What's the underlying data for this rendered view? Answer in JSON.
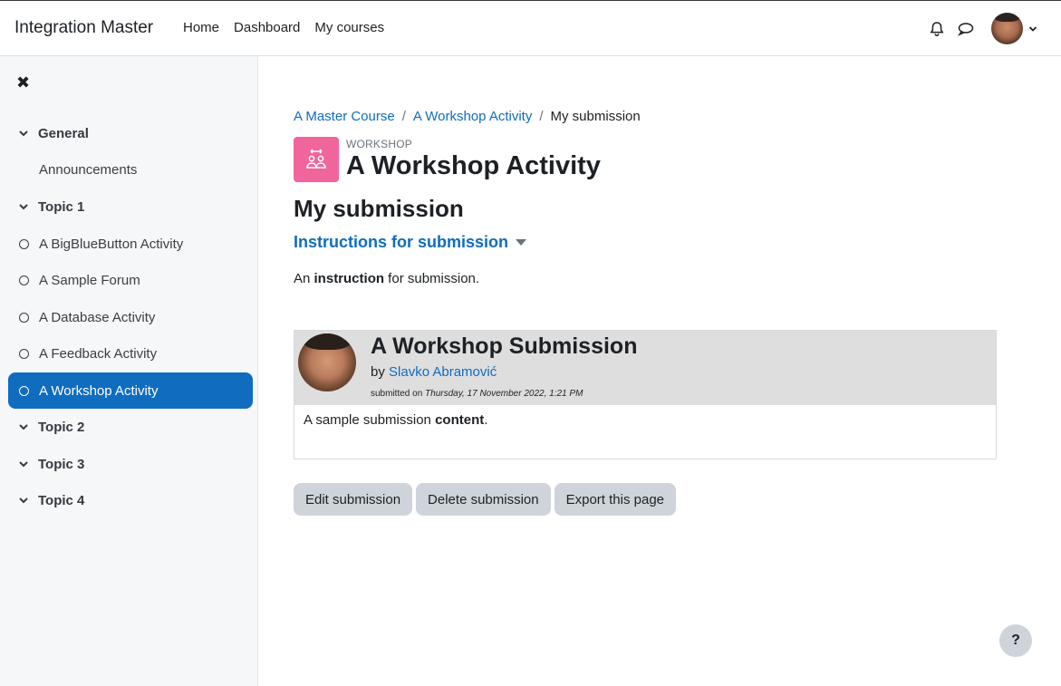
{
  "navbar": {
    "brand": "Integration Master",
    "links": [
      "Home",
      "Dashboard",
      "My courses"
    ]
  },
  "sidebar": {
    "items": [
      {
        "label": "General",
        "kind": "section"
      },
      {
        "label": "Announcements",
        "kind": "plain"
      },
      {
        "label": "Topic 1",
        "kind": "section"
      },
      {
        "label": "A BigBlueButton Activity",
        "kind": "activity"
      },
      {
        "label": "A Sample Forum",
        "kind": "activity"
      },
      {
        "label": "A Database Activity",
        "kind": "activity"
      },
      {
        "label": "A Feedback Activity",
        "kind": "activity"
      },
      {
        "label": "A Workshop Activity",
        "kind": "activity",
        "active": true
      },
      {
        "label": "Topic 2",
        "kind": "section"
      },
      {
        "label": "Topic 3",
        "kind": "section"
      },
      {
        "label": "Topic 4",
        "kind": "section"
      }
    ]
  },
  "breadcrumb": {
    "course": "A Master Course",
    "sep": "/",
    "activity": "A Workshop Activity",
    "current": "My submission"
  },
  "activity": {
    "type": "WORKSHOP",
    "title": "A Workshop Activity",
    "icon": "workshop-icon",
    "icon_color": "#f0659c"
  },
  "page": {
    "heading": "My submission",
    "instructions_label": "Instructions for submission",
    "instruction_prefix": "An ",
    "instruction_bold": "instruction",
    "instruction_suffix": " for submission."
  },
  "submission": {
    "title": "A Workshop Submission",
    "by_prefix": "by ",
    "author": "Slavko Abramović",
    "submitted_prefix": "submitted on ",
    "submitted_date": "Thursday, 17 November 2022, 1:21 PM",
    "content_prefix": "A sample submission ",
    "content_bold": "content",
    "content_suffix": "."
  },
  "buttons": {
    "edit": "Edit submission",
    "delete": "Delete submission",
    "export": "Export this page"
  },
  "help": {
    "label": "?"
  },
  "colors": {
    "link": "#0f6cbf",
    "active_bg": "#0f6cbf",
    "sidebar_bg": "#f5f7f9",
    "button_bg": "#ced4da"
  }
}
